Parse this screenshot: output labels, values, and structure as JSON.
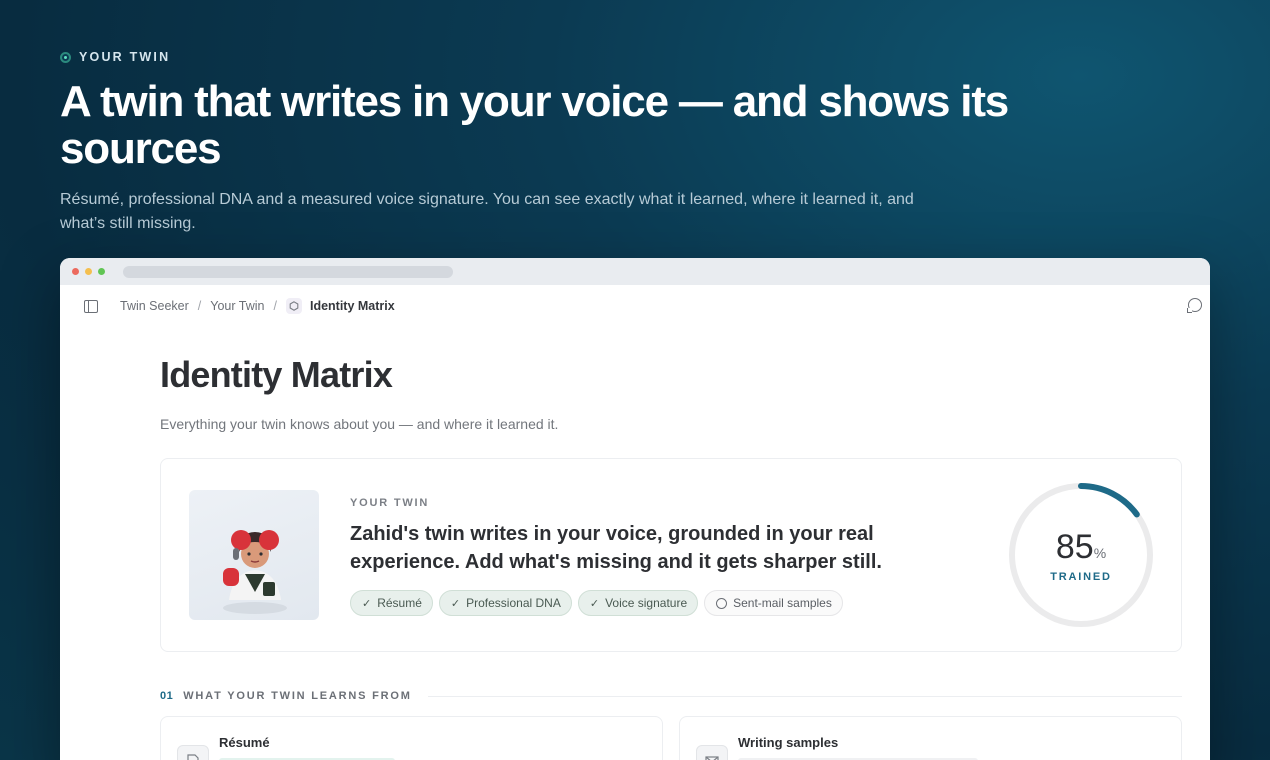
{
  "hero": {
    "eyebrow": "YOUR TWIN",
    "title": "A twin that writes in your voice — and shows its sources",
    "description": "Résumé, professional DNA and a measured voice signature. You can see exactly what it learned, where it learned it, and what’s still missing."
  },
  "breadcrumb": {
    "items": [
      "Twin Seeker",
      "Your Twin"
    ],
    "current": "Identity Matrix",
    "separator": "/"
  },
  "page": {
    "title": "Identity Matrix",
    "subtitle": "Everything your twin knows about you — and where it learned it."
  },
  "card": {
    "eyebrow": "YOUR TWIN",
    "headline": "Zahid's twin writes in your voice, grounded in your real experience. Add what's missing and it gets sharper still.",
    "chips": [
      {
        "label": "Résumé",
        "done": true
      },
      {
        "label": "Professional DNA",
        "done": true
      },
      {
        "label": "Voice signature",
        "done": true
      },
      {
        "label": "Sent-mail samples",
        "done": false
      }
    ],
    "progress_value": "85",
    "progress_unit": "%",
    "progress_fraction": 0.85,
    "progress_label": "TRAINED"
  },
  "section": {
    "number": "01",
    "title": "WHAT YOUR TWIN LEARNS FROM"
  },
  "tiles": [
    {
      "title": "Résumé",
      "icon": "document-icon"
    },
    {
      "title": "Writing samples",
      "icon": "mail-icon"
    }
  ],
  "colors": {
    "accent": "#1e6a88",
    "ring_track": "#ebebec",
    "chip_done_bg": "#e8f0ec"
  }
}
